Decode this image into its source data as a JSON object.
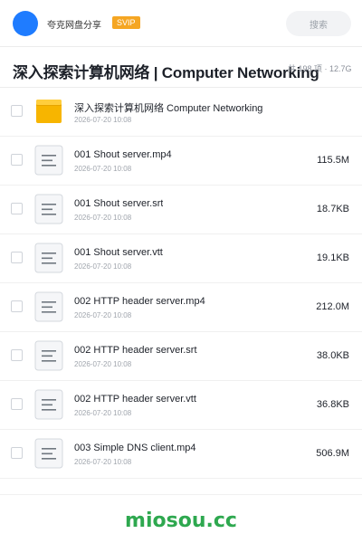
{
  "header": {
    "share_name": "夸克网盘分享",
    "badge": "SVIP",
    "search_label": "搜索",
    "avatar_color": "#1f7cff",
    "badge_color": "#f5a623"
  },
  "folder": {
    "title": "深入探索计算机网络 | Computer Networking",
    "meta": "共 198 项 · 12.7G"
  },
  "files": [
    {
      "name": "深入探索计算机网络 Computer Networking",
      "date": "2026-07-20 10:08",
      "size": "",
      "icon": "folder-icon"
    },
    {
      "name": "001 Shout server.mp4",
      "date": "2026-07-20 10:08",
      "size": "115.5M",
      "icon": "file-icon"
    },
    {
      "name": "001 Shout server.srt",
      "date": "2026-07-20 10:08",
      "size": "18.7KB",
      "icon": "file-icon"
    },
    {
      "name": "001 Shout server.vtt",
      "date": "2026-07-20 10:08",
      "size": "19.1KB",
      "icon": "file-icon"
    },
    {
      "name": "002 HTTP header server.mp4",
      "date": "2026-07-20 10:08",
      "size": "212.0M",
      "icon": "file-icon"
    },
    {
      "name": "002 HTTP header server.srt",
      "date": "2026-07-20 10:08",
      "size": "38.0KB",
      "icon": "file-icon"
    },
    {
      "name": "002 HTTP header server.vtt",
      "date": "2026-07-20 10:08",
      "size": "36.8KB",
      "icon": "file-icon"
    },
    {
      "name": "003 Simple DNS client.mp4",
      "date": "2026-07-20 10:08",
      "size": "506.9M",
      "icon": "file-icon"
    }
  ],
  "watermark": "miosou.cc",
  "colors": {
    "folder": "#f7b500",
    "watermark": "#2ea84f"
  }
}
